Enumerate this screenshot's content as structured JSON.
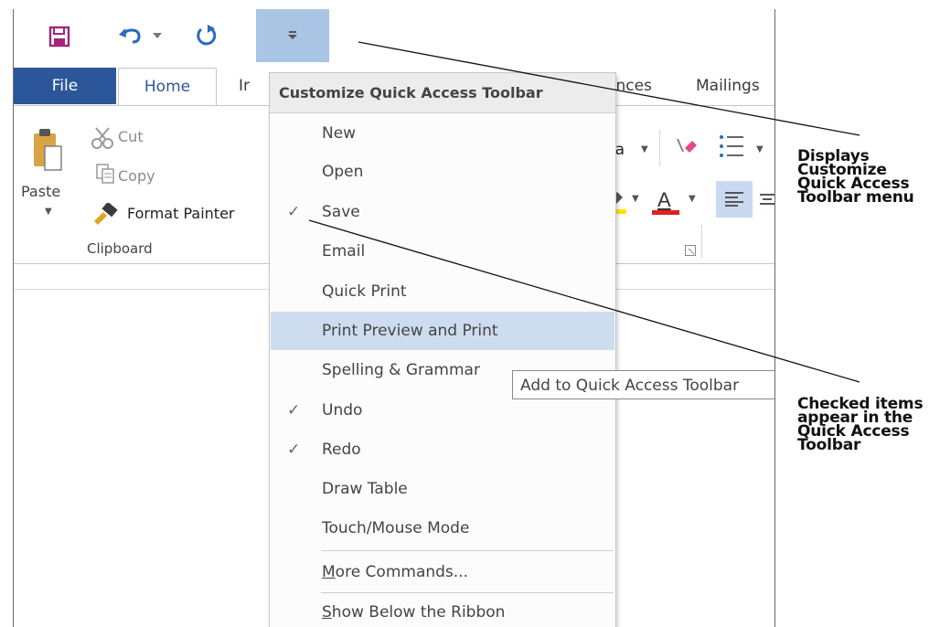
{
  "qat": {
    "save_icon": "save-icon",
    "undo_icon": "undo-icon",
    "redo_icon": "redo-icon",
    "customize_icon": "customize-dropdown-icon",
    "accent": "#a9c5e6"
  },
  "tabs": {
    "file": "File",
    "home": "Home",
    "insert_fragment": "Ir",
    "references_fragment": "ences",
    "mailings": "Mailings",
    "file_color": "#2b579a"
  },
  "ribbon": {
    "paste": "Paste",
    "cut": "Cut",
    "copy": "Copy",
    "format_painter": "Format Painter",
    "clipboard_group": "Clipboard",
    "font_size_label": "Aa",
    "font_color_letter": "A",
    "font_color": "#e02020",
    "highlight_color": "#ffe400"
  },
  "menu": {
    "title": "Customize Quick Access Toolbar",
    "items": [
      {
        "label": "New",
        "checked": false,
        "highlighted": false
      },
      {
        "label": "Open",
        "checked": false,
        "highlighted": false
      },
      {
        "label": "Save",
        "checked": true,
        "highlighted": false
      },
      {
        "label": "Email",
        "checked": false,
        "highlighted": false
      },
      {
        "label": "Quick Print",
        "checked": false,
        "highlighted": false
      },
      {
        "label": "Print Preview and Print",
        "checked": false,
        "highlighted": true
      },
      {
        "label": "Spelling & Grammar",
        "checked": false,
        "highlighted": false
      },
      {
        "label": "Undo",
        "checked": true,
        "highlighted": false
      },
      {
        "label": "Redo",
        "checked": true,
        "highlighted": false
      },
      {
        "label": "Draw Table",
        "checked": false,
        "highlighted": false
      },
      {
        "label": "Touch/Mouse Mode",
        "checked": false,
        "highlighted": false
      }
    ],
    "more_commands": {
      "accel": "M",
      "rest": "ore Commands..."
    },
    "show_below": {
      "accel": "S",
      "rest": "how Below the Ribbon"
    },
    "check_glyph": "✓",
    "highlight_color": "#cddcef"
  },
  "tooltip": "Add to Quick Access Toolbar",
  "callouts": {
    "top": [
      "Displays",
      "Customize",
      "Quick Access",
      "Toolbar menu"
    ],
    "bottom": [
      "Checked items",
      "appear in the",
      "Quick Access",
      "Toolbar"
    ]
  }
}
